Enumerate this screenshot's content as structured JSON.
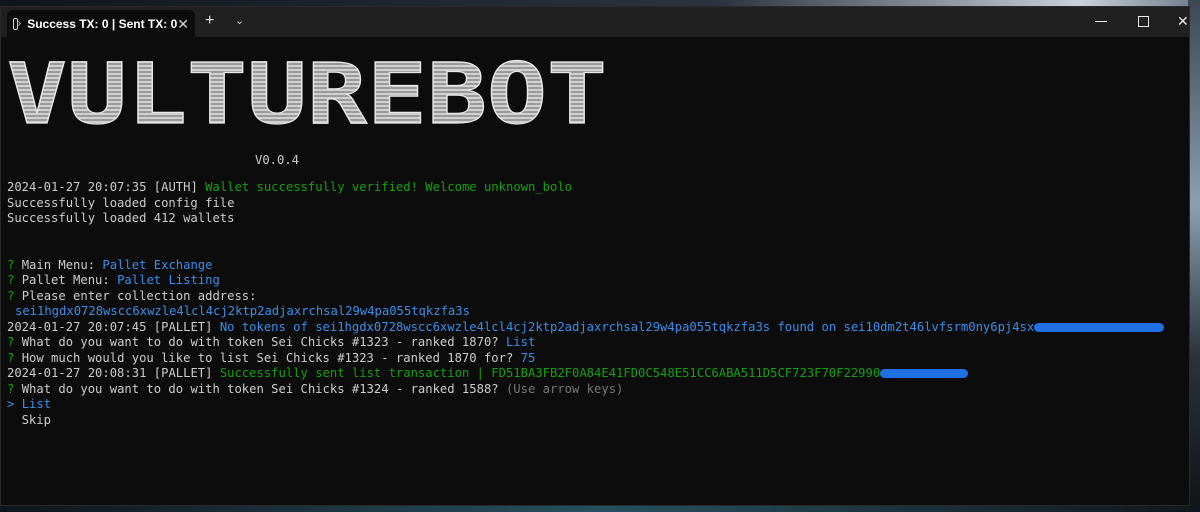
{
  "window": {
    "tab_title": "Success TX: 0 | Sent TX: 0",
    "tab_close": "✕",
    "new_tab": "+",
    "dropdown": "⌄",
    "close": "✕"
  },
  "terminal": {
    "banner_text": "VULTUREBOT",
    "version": "V0.0.4",
    "lines": [
      {
        "time": "2024-01-27 20:07:35",
        "tag": "[AUTH]",
        "msg": "Wallet successfully verified! Welcome unknown_bolo"
      },
      {
        "text": "Successfully loaded config file"
      },
      {
        "text": "Successfully loaded 412 wallets"
      }
    ],
    "prompt_mark": "?",
    "main_menu_label": "Main Menu:",
    "main_menu_value": "Pallet Exchange",
    "pallet_menu_label": "Pallet Menu:",
    "pallet_menu_value": "Pallet Listing",
    "collection_prompt": "Please enter collection address:",
    "collection_address": "sei1hgdx0728wscc6xwzle4lcl4cj2ktp2adjaxrchsal29w4pa055tqkzfa3s",
    "pallet1_time": "2024-01-27 20:07:45",
    "pallet1_tag": "[PALLET]",
    "pallet1_msg": "No tokens of sei1hgdx0728wscc6xwzle4lcl4cj2ktp2adjaxrchsal29w4pa055tqkzfa3s found on sei10dm2t46lvfsrm0ny6pj4sx",
    "q1_text": "What do you want to do with token Sei Chicks #1323 - ranked 1870?",
    "q1_answer": "List",
    "q2_text": "How much would you like to list Sei Chicks #1323 - ranked 1870 for?",
    "q2_answer": "75",
    "pallet2_time": "2024-01-27 20:08:31",
    "pallet2_tag": "[PALLET]",
    "pallet2_msg": "Successfully sent list transaction | FD51BA3FB2F0A84E41FD0C548E51CC6ABA511D5CF723F70F22990",
    "q3_text": "What do you want to do with token Sei Chicks #1324 - ranked 1588?",
    "q3_hint": "(Use arrow keys)",
    "cursor": ">",
    "option_list": "List",
    "option_skip": "Skip"
  }
}
